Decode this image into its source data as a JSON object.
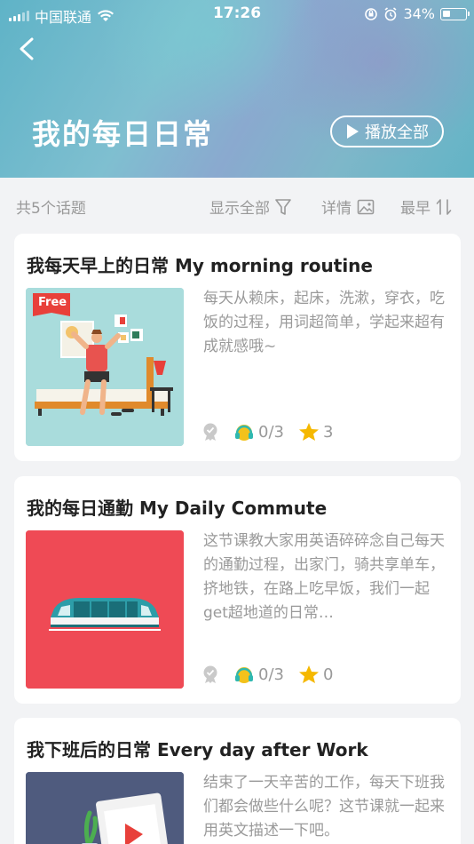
{
  "status": {
    "carrier": "中国联通",
    "time": "17:26",
    "battery": "34%",
    "battery_level": 0.34
  },
  "header": {
    "title": "我的每日日常",
    "play_all": "播放全部"
  },
  "filter": {
    "count": "共5个话题",
    "show_all": "显示全部",
    "details": "详情",
    "sort": "最早"
  },
  "cards": [
    {
      "title": "我每天早上的日常 My morning routine",
      "badge": "Free",
      "desc": "每天从赖床，起床，洗漱，穿衣，吃饭的过程，用词超简单，学起来超有成就感哦~",
      "progress": "0/3",
      "stars": "3"
    },
    {
      "title": "我的每日通勤 My Daily Commute",
      "desc": "这节课教大家用英语碎碎念自己每天的通勤过程，出家门，骑共享单车，挤地铁，在路上吃早饭，我们一起get超地道的日常…",
      "progress": "0/3",
      "stars": "0"
    },
    {
      "title": "我下班后的日常 Every day after Work",
      "desc": "结束了一天辛苦的工作，每天下班我们都会做些什么呢？这节课就一起来用英文描述一下吧。"
    }
  ],
  "colors": {
    "accent_star": "#f5b800",
    "headphone": "#f3c21b",
    "free_badge": "#e8403a",
    "commute_bg": "#ef4a55",
    "morning_bg": "#a9dcdc",
    "work_bg": "#4f5b7e"
  }
}
